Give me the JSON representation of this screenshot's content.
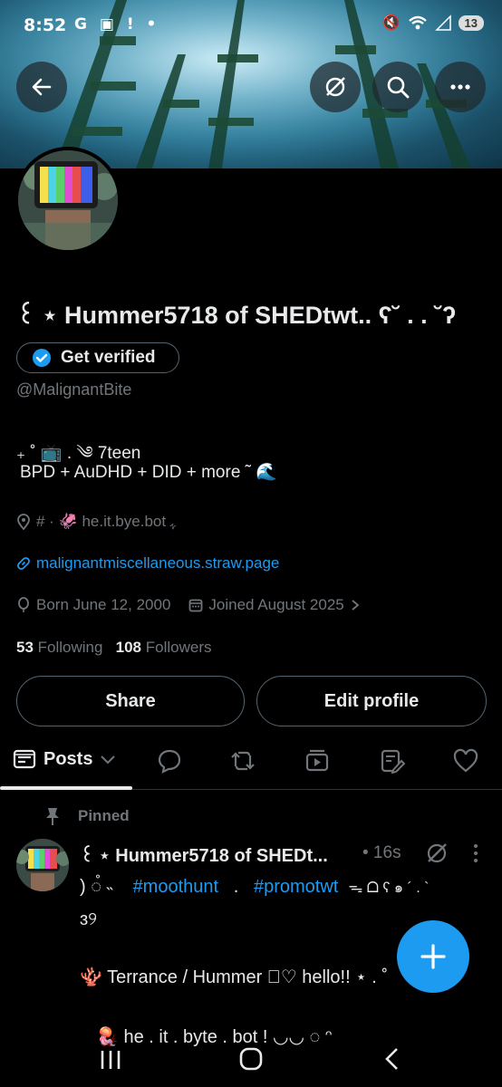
{
  "status": {
    "time": "8:52",
    "left_icons": "G ▣ ! •",
    "battery": "13"
  },
  "profile": {
    "name": "꒰ ⋆ Hummer5718 of SHEDtwt.. ʕ˘ . . ˘ʔ",
    "verify_label": "Get verified",
    "handle": "@MalignantBite",
    "bio_line1": "₊ ˚ 📺 . ༄ 7teen",
    "bio_line2": "BPD + AuDHD + DID + more ˜  🌊",
    "location": "# · 🦑 he.it.bye.bot ﮩ",
    "website": "malignantmiscellaneous.straw.page",
    "born": "Born June 12, 2000",
    "joined": "Joined August 2025",
    "following_count": "53",
    "following_label": "Following",
    "followers_count": "108",
    "followers_label": "Followers",
    "share_label": "Share",
    "edit_label": "Edit profile"
  },
  "tabs": {
    "posts_label": "Posts"
  },
  "post": {
    "pinned_label": "Pinned",
    "author": "꒰ ⋆ Hummer5718 of SHEDt...",
    "time": "• 16s",
    "line1_prefix": ") ◌̊ ˵",
    "hashtag1": "#moothunt",
    "separator": ".",
    "hashtag2": "#promotwt",
    "line1_suffix": "ᯓ ᗝ ʕ ๑ ´ . `",
    "line2": "ɜ୨",
    "line3": "🪸  Terrance / Hummer  ⃝♡  hello!!  ⋆ . ˚",
    "line4": "🪼 he . it . byte . bot  !      ◡◡     ◌ ᵔ"
  },
  "colors": {
    "accent": "#1d9bf0",
    "background": "#000000",
    "muted": "#71767b",
    "text": "#e7e9ea"
  },
  "icons": {
    "back": "back-arrow-icon",
    "grok": "slash-circle-icon",
    "search": "search-icon",
    "more": "more-icon"
  }
}
